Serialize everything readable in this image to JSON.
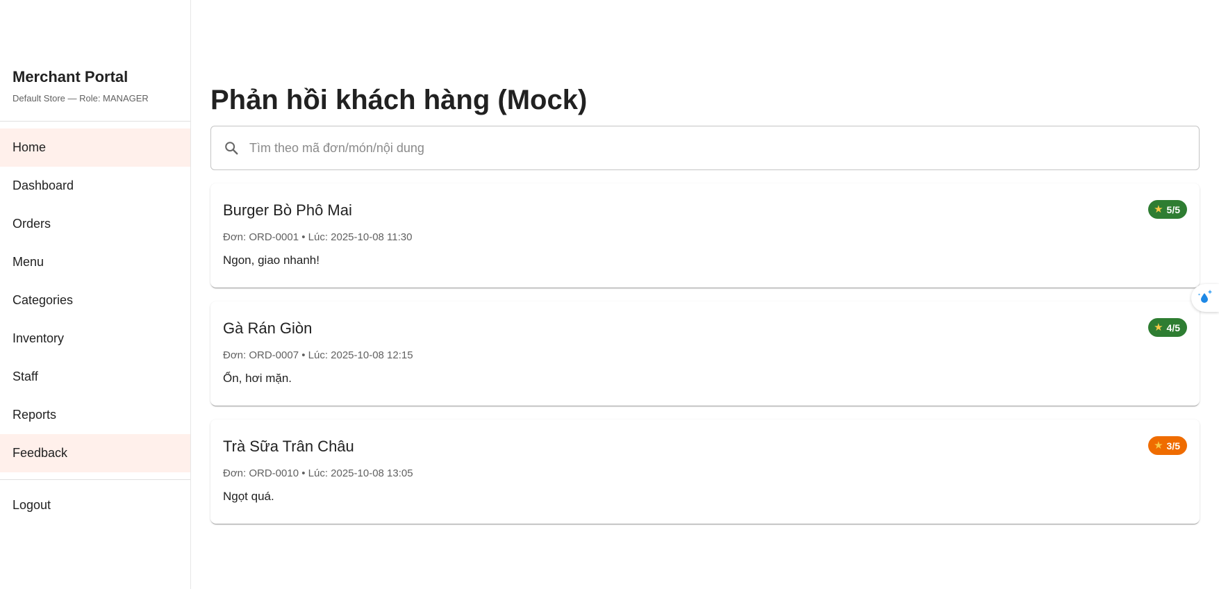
{
  "sidebar": {
    "brand_title": "Merchant Portal",
    "brand_sub": "Default Store — Role: MANAGER",
    "items": [
      {
        "label": "Home",
        "active": true
      },
      {
        "label": "Dashboard",
        "active": false
      },
      {
        "label": "Orders",
        "active": false
      },
      {
        "label": "Menu",
        "active": false
      },
      {
        "label": "Categories",
        "active": false
      },
      {
        "label": "Inventory",
        "active": false
      },
      {
        "label": "Staff",
        "active": false
      },
      {
        "label": "Reports",
        "active": false
      },
      {
        "label": "Feedback",
        "active": true
      }
    ],
    "logout_label": "Logout"
  },
  "main": {
    "title": "Phản hồi khách hàng (Mock)",
    "search": {
      "placeholder": "Tìm theo mã đơn/món/nội dung",
      "value": "",
      "icon": "search-icon"
    },
    "feedback": [
      {
        "title": "Burger Bò Phô Mai",
        "meta": "Đơn: ORD-0001 • Lúc: 2025-10-08 11:30",
        "text": "Ngon, giao nhanh!",
        "rating": "5/5",
        "badge_color": "#2e7d32"
      },
      {
        "title": "Gà Rán Giòn",
        "meta": "Đơn: ORD-0007 • Lúc: 2025-10-08 12:15",
        "text": "Ổn, hơi mặn.",
        "rating": "4/5",
        "badge_color": "#2e7d32"
      },
      {
        "title": "Trà Sữa Trân Châu",
        "meta": "Đơn: ORD-0010 • Lúc: 2025-10-08 13:05",
        "text": "Ngọt quá.",
        "rating": "3/5",
        "badge_color": "#ef6c00"
      }
    ]
  },
  "colors": {
    "active_nav_bg": "#fff0eb",
    "star": "#f7c948",
    "widget_accent": "#1e88e5"
  }
}
